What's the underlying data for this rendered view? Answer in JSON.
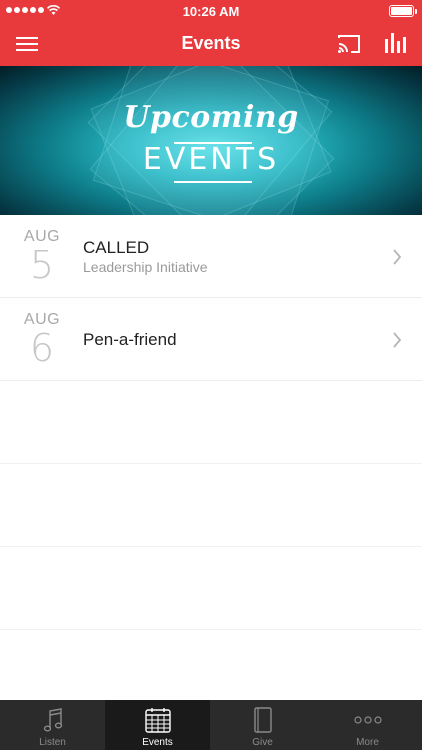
{
  "status_bar": {
    "time": "10:26 AM"
  },
  "nav_bar": {
    "title": "Events",
    "menu_icon": "hamburger-menu-icon",
    "cast_icon": "cast-icon",
    "stats_icon": "bar-chart-icon",
    "color": "#e8393d"
  },
  "banner": {
    "script_text": "Upcoming",
    "title_text": "EVENTS"
  },
  "events": [
    {
      "month": "AUG",
      "day": "5",
      "name": "CALLED",
      "subtitle": "Leadership Initiative"
    },
    {
      "month": "AUG",
      "day": "6",
      "name": "Pen-a-friend",
      "subtitle": ""
    }
  ],
  "tab_bar": {
    "tabs": [
      {
        "label": "Listen",
        "icon": "music-note-icon"
      },
      {
        "label": "Events",
        "icon": "calendar-icon",
        "active": true
      },
      {
        "label": "Give",
        "icon": "book-icon"
      },
      {
        "label": "More",
        "icon": "more-dots-icon"
      }
    ]
  }
}
